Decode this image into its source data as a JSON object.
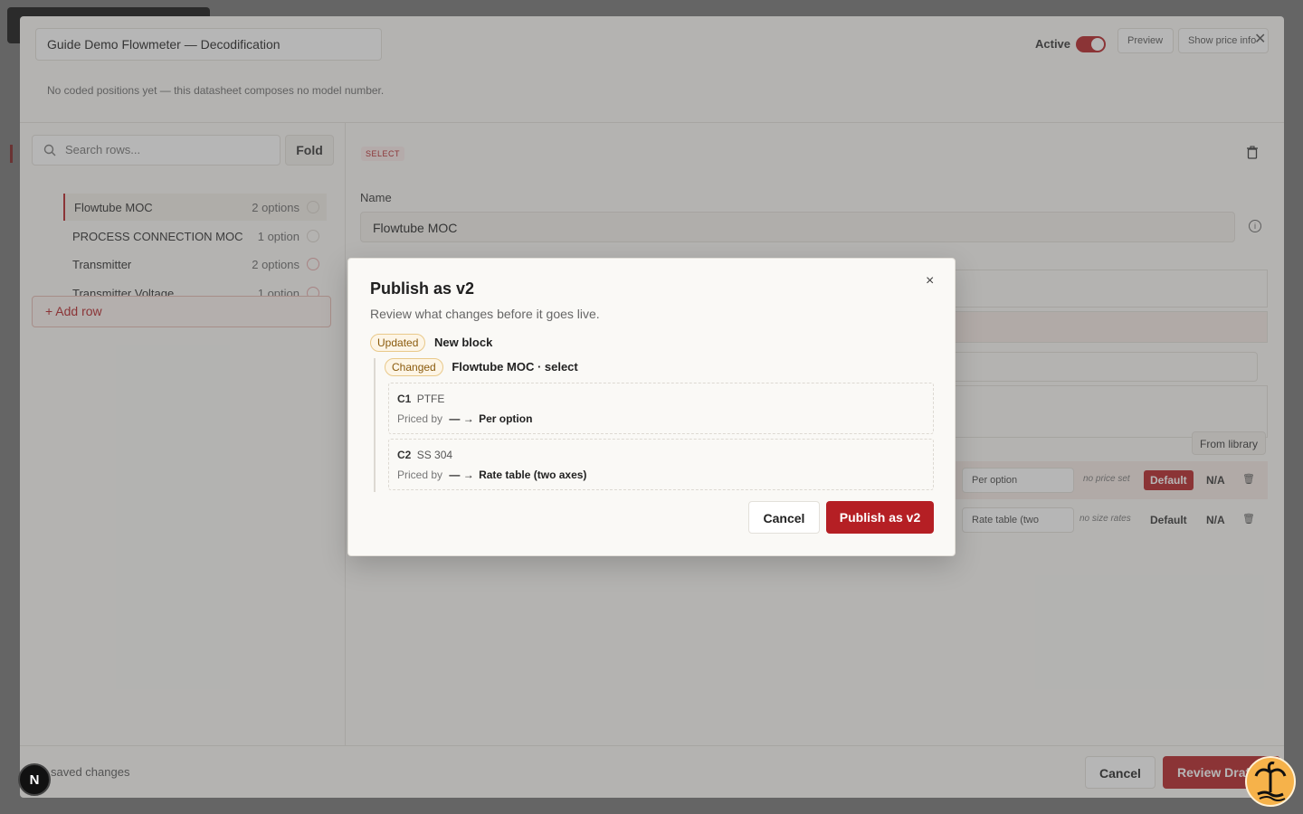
{
  "header": {
    "title": "Guide Demo Flowmeter — Decodification",
    "note": "No coded positions yet — this datasheet composes no model number.",
    "active_label": "Active",
    "preview_label": "Preview",
    "price_info_label": "Show price info",
    "close_glyph": "✕"
  },
  "sidebar": {
    "search_placeholder": "Search rows...",
    "fold_label": "Fold",
    "rows": [
      {
        "label": "Flowtube MOC",
        "count": "2 options"
      },
      {
        "label": "PROCESS CONNECTION MOC",
        "count": "1 option"
      },
      {
        "label": "Transmitter",
        "count": "2 options"
      },
      {
        "label": "Transmitter Voltage",
        "count": "1 option"
      }
    ],
    "add_row_label": "+  Add row"
  },
  "editor": {
    "type_tag": "SELECT",
    "name_label": "Name",
    "name_value": "Flowtube MOC",
    "from_library_label": "From library",
    "options": [
      {
        "pricing": "Per option",
        "muted": "no price set",
        "default": "Default",
        "na": "N/A"
      },
      {
        "pricing": "Rate table (two",
        "muted": "no size rates",
        "default": "Default",
        "na": "N/A"
      }
    ]
  },
  "footer": {
    "unsaved_label": "saved changes",
    "cancel_label": "Cancel",
    "review_label": "Review Draft"
  },
  "modal": {
    "title": "Publish as v2",
    "subtitle": "Review what changes before it goes live.",
    "updated_badge": "Updated",
    "updated_text": "New block",
    "changed_badge": "Changed",
    "changed_text": "Flowtube MOC · select",
    "changes": [
      {
        "code": "C1",
        "name": "PTFE",
        "priced_label": "Priced by",
        "arrow": "— →",
        "value": "Per option"
      },
      {
        "code": "C2",
        "name": "SS 304",
        "priced_label": "Priced by",
        "arrow": "— →",
        "value": "Rate table (two axes)"
      }
    ],
    "cancel_label": "Cancel",
    "publish_label": "Publish as v2",
    "close_glyph": "×"
  },
  "corner": {
    "n_badge": "N"
  },
  "colors": {
    "accent": "#b51f24",
    "panel": "#fbfaf7",
    "overlay": "rgba(80,80,80,0.42)"
  }
}
